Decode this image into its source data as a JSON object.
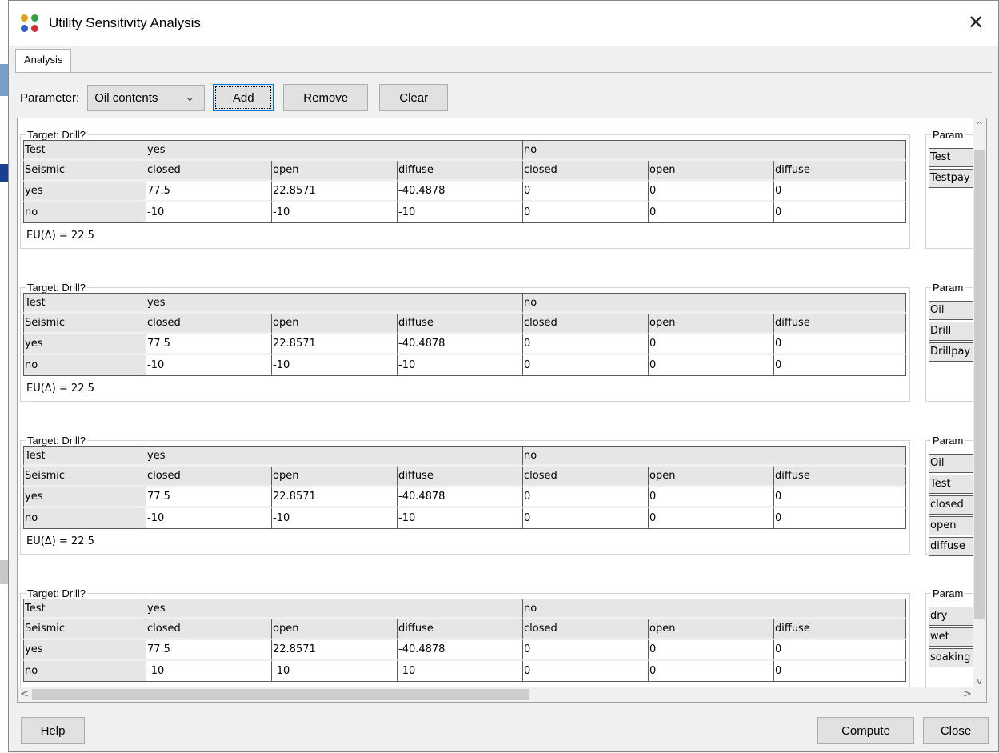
{
  "window": {
    "title": "Utility Sensitivity Analysis",
    "close_glyph": "✕"
  },
  "tabs": [
    {
      "label": "Analysis"
    }
  ],
  "toolbar": {
    "parameter_label": "Parameter:",
    "parameter_value": "Oil contents",
    "add_label": "Add",
    "remove_label": "Remove",
    "clear_label": "Clear"
  },
  "groups": [
    {
      "legend": "Target: Drill?",
      "header1": {
        "label": "Test",
        "yes": "yes",
        "no": "no"
      },
      "header2": [
        "Seismic",
        "closed",
        "open",
        "diffuse",
        "closed",
        "open",
        "diffuse"
      ],
      "rows": [
        [
          "yes",
          "77.5",
          "22.8571",
          "-40.4878",
          "0",
          "0",
          "0"
        ],
        [
          "no",
          "-10",
          "-10",
          "-10",
          "0",
          "0",
          "0"
        ]
      ],
      "eu": "EU(Δ) = 22.5",
      "param_legend": "Param",
      "params": [
        "Test",
        "Testpay"
      ]
    },
    {
      "legend": "Target: Drill?",
      "header1": {
        "label": "Test",
        "yes": "yes",
        "no": "no"
      },
      "header2": [
        "Seismic",
        "closed",
        "open",
        "diffuse",
        "closed",
        "open",
        "diffuse"
      ],
      "rows": [
        [
          "yes",
          "77.5",
          "22.8571",
          "-40.4878",
          "0",
          "0",
          "0"
        ],
        [
          "no",
          "-10",
          "-10",
          "-10",
          "0",
          "0",
          "0"
        ]
      ],
      "eu": "EU(Δ) = 22.5",
      "param_legend": "Param",
      "params": [
        "Oil",
        "Drill",
        "Drillpay"
      ]
    },
    {
      "legend": "Target: Drill?",
      "header1": {
        "label": "Test",
        "yes": "yes",
        "no": "no"
      },
      "header2": [
        "Seismic",
        "closed",
        "open",
        "diffuse",
        "closed",
        "open",
        "diffuse"
      ],
      "rows": [
        [
          "yes",
          "77.5",
          "22.8571",
          "-40.4878",
          "0",
          "0",
          "0"
        ],
        [
          "no",
          "-10",
          "-10",
          "-10",
          "0",
          "0",
          "0"
        ]
      ],
      "eu": "EU(Δ) = 22.5",
      "param_legend": "Param",
      "params": [
        "Oil",
        "Test",
        "closed",
        "open",
        "diffuse"
      ]
    },
    {
      "legend": "Target: Drill?",
      "header1": {
        "label": "Test",
        "yes": "yes",
        "no": "no"
      },
      "header2": [
        "Seismic",
        "closed",
        "open",
        "diffuse",
        "closed",
        "open",
        "diffuse"
      ],
      "rows": [
        [
          "yes",
          "77.5",
          "22.8571",
          "-40.4878",
          "0",
          "0",
          "0"
        ],
        [
          "no",
          "-10",
          "-10",
          "-10",
          "0",
          "0",
          "0"
        ]
      ],
      "eu": "",
      "param_legend": "Param",
      "params": [
        "dry",
        "wet",
        "soaking"
      ]
    }
  ],
  "scrollbar": {
    "up": "^",
    "down": "v",
    "left": "<",
    "right": ">"
  },
  "footer": {
    "help_label": "Help",
    "compute_label": "Compute",
    "close_label": "Close"
  }
}
